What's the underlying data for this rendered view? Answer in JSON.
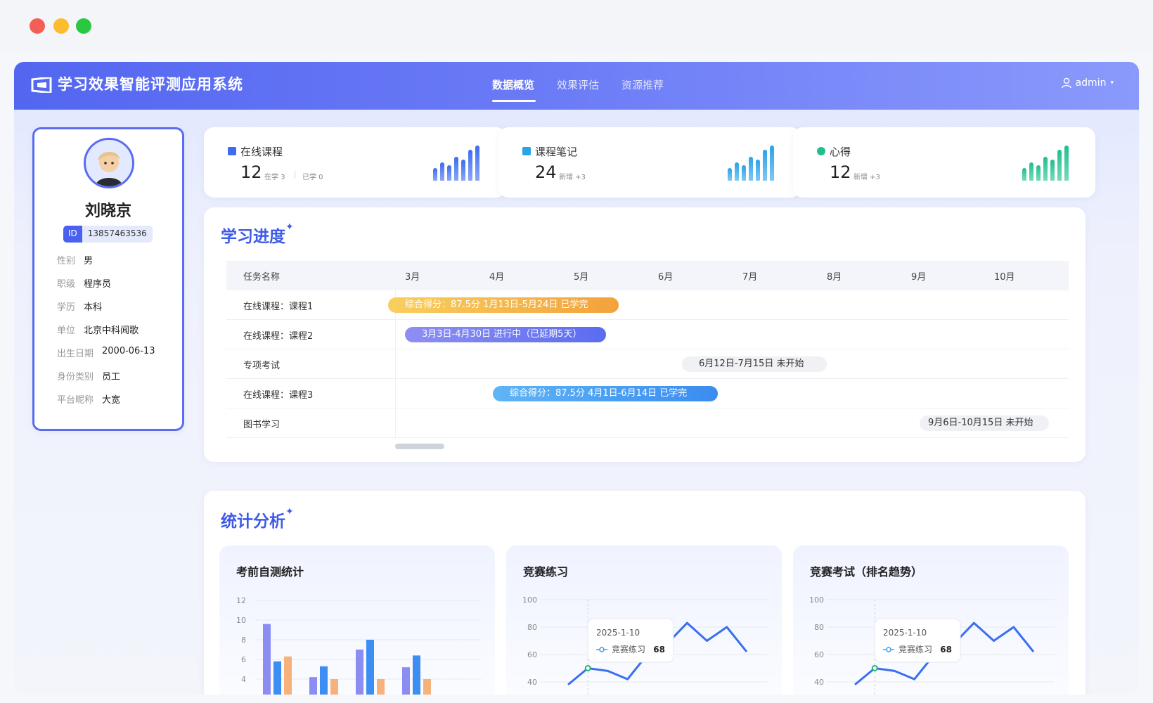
{
  "window": {
    "dot_colors": [
      "#f35f57",
      "#fbbd2e",
      "#2ac840"
    ]
  },
  "app": {
    "title": "学习效果智能评测应用系统"
  },
  "nav": {
    "tabs": [
      {
        "label": "数据概览",
        "active": true
      },
      {
        "label": "效果评估",
        "active": false
      },
      {
        "label": "资源推荐",
        "active": false
      }
    ],
    "user": "admin"
  },
  "profile": {
    "name": "刘晓京",
    "id_label": "ID",
    "id_value": "13857463536",
    "fields": [
      {
        "key": "性别",
        "value": "男"
      },
      {
        "key": "职级",
        "value": "程序员"
      },
      {
        "key": "学历",
        "value": "本科"
      },
      {
        "key": "单位",
        "value": "北京中科闻歌"
      },
      {
        "key": "出生日期",
        "value": "2000-06-13"
      },
      {
        "key": "身份类别",
        "value": "员工"
      },
      {
        "key": "平台昵称",
        "value": "大宽"
      }
    ]
  },
  "stats": [
    {
      "label": "在线课程",
      "value": "12",
      "sub1": "在学 3",
      "sub2": "已学 0",
      "icon": "book-icon",
      "color": "#3d6cf0"
    },
    {
      "label": "课程笔记",
      "value": "24",
      "sub1": "新增 +3",
      "sub2": "",
      "icon": "note-icon",
      "color": "#2aa3e8"
    },
    {
      "label": "心得",
      "value": "12",
      "sub1": "新增 +3",
      "sub2": "",
      "icon": "heart-icon",
      "color": "#1fbf8f"
    }
  ],
  "progress": {
    "title": "学习进度",
    "columns": [
      "任务名称",
      "3月",
      "4月",
      "5月",
      "6月",
      "7月",
      "8月",
      "9月",
      "10月"
    ],
    "rows": [
      {
        "task": "在线课程：课程1",
        "bar": "综合得分：87.5分    1月13日-5月24日    已学完",
        "status": "done-orange"
      },
      {
        "task": "在线课程：课程2",
        "bar": "3月3日-4月30日    进行中（已延期5天）",
        "status": "delayed"
      },
      {
        "task": "专项考试",
        "bar": "6月12日-7月15日    未开始",
        "status": "pending"
      },
      {
        "task": "在线课程：课程3",
        "bar": "综合得分：87.5分    4月1日-6月14日    已学完",
        "status": "done-blue"
      },
      {
        "task": "图书学习",
        "bar": "9月6日-10月15日    未开始",
        "status": "pending"
      }
    ]
  },
  "analysis": {
    "title": "统计分析",
    "cards": [
      {
        "title": "考前自测统计",
        "yticks": [
          "12",
          "10",
          "8",
          "6",
          "4"
        ]
      },
      {
        "title": "竞赛练习",
        "yticks": [
          "100",
          "80",
          "60",
          "40"
        ],
        "tooltip_date": "2025-1-10",
        "tooltip_series": "竞赛练习",
        "tooltip_value": "68"
      },
      {
        "title": "竞赛考试（排名趋势）",
        "yticks": [
          "100",
          "80",
          "60",
          "40"
        ],
        "tooltip_date": "2025-1-10",
        "tooltip_series": "竞赛练习",
        "tooltip_value": "68"
      }
    ]
  },
  "chart_data": [
    {
      "type": "bar",
      "title": "考前自测统计",
      "ylim": [
        4,
        12
      ],
      "series": [
        {
          "values": [
            9.6,
            4.2,
            7.0,
            5.2
          ]
        },
        {
          "values": [
            5.8,
            5.3,
            8.0,
            6.4
          ]
        },
        {
          "values": [
            6.3,
            4.0,
            4.0,
            4.0
          ]
        }
      ]
    },
    {
      "type": "line",
      "title": "竞赛练习",
      "ylim": [
        40,
        100
      ],
      "series": [
        {
          "name": "竞赛练习",
          "values": [
            38,
            50,
            48,
            42,
            60,
            68,
            83,
            70,
            80,
            62
          ]
        }
      ]
    },
    {
      "type": "line",
      "title": "竞赛考试（排名趋势）",
      "ylim": [
        40,
        100
      ],
      "series": [
        {
          "name": "竞赛练习",
          "values": [
            38,
            50,
            48,
            42,
            60,
            68,
            83,
            70,
            80,
            62
          ]
        }
      ]
    }
  ]
}
